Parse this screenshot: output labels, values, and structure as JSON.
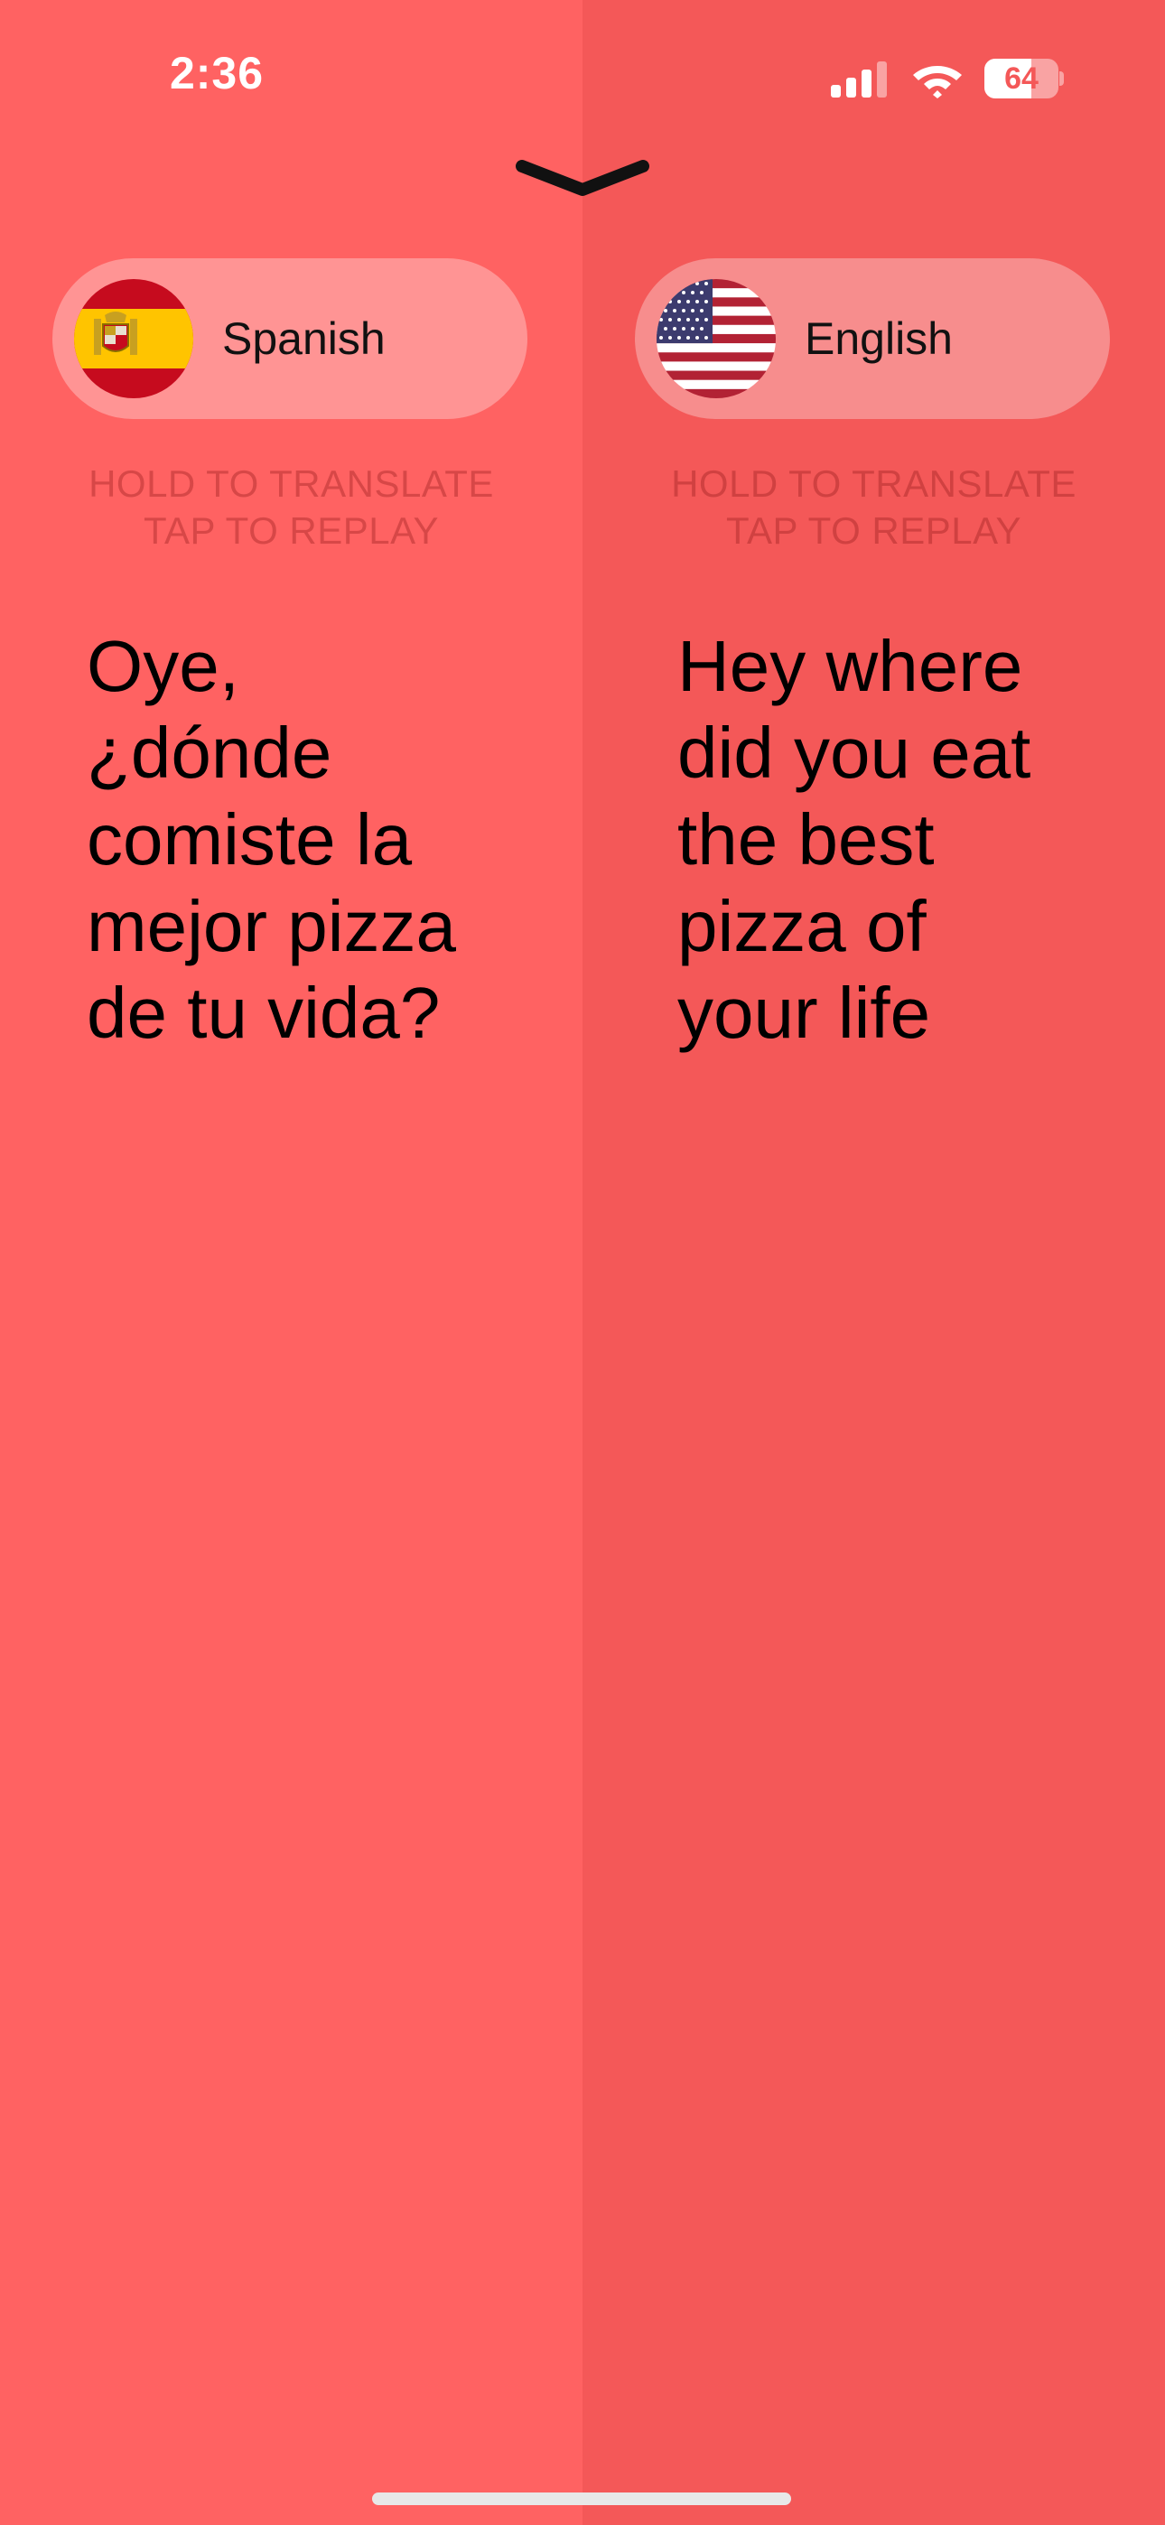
{
  "status_bar": {
    "time": "2:36",
    "battery_percent": "64",
    "battery_level": 0.64,
    "signal_icon": "cellular-signal-icon",
    "wifi_icon": "wifi-icon"
  },
  "dismiss": {
    "icon": "chevron-down-icon"
  },
  "left_panel": {
    "language": "Spanish",
    "flag_icon": "spain-flag-icon",
    "hint_line1": "HOLD TO TRANSLATE",
    "hint_line2": "TAP TO REPLAY",
    "phrase_lines": [
      "Oye,",
      "¿dónde",
      "comiste la",
      "mejor pizza",
      "de tu vida?"
    ]
  },
  "right_panel": {
    "language": "English",
    "flag_icon": "usa-flag-icon",
    "hint_line1": "HOLD TO TRANSLATE",
    "hint_line2": "TAP TO REPLAY",
    "phrase_lines": [
      "Hey where",
      "did you eat",
      "the best",
      "pizza of",
      "your life"
    ]
  },
  "colors": {
    "left_background": "#FF6262",
    "right_background": "#F45858",
    "text": "#000000"
  }
}
